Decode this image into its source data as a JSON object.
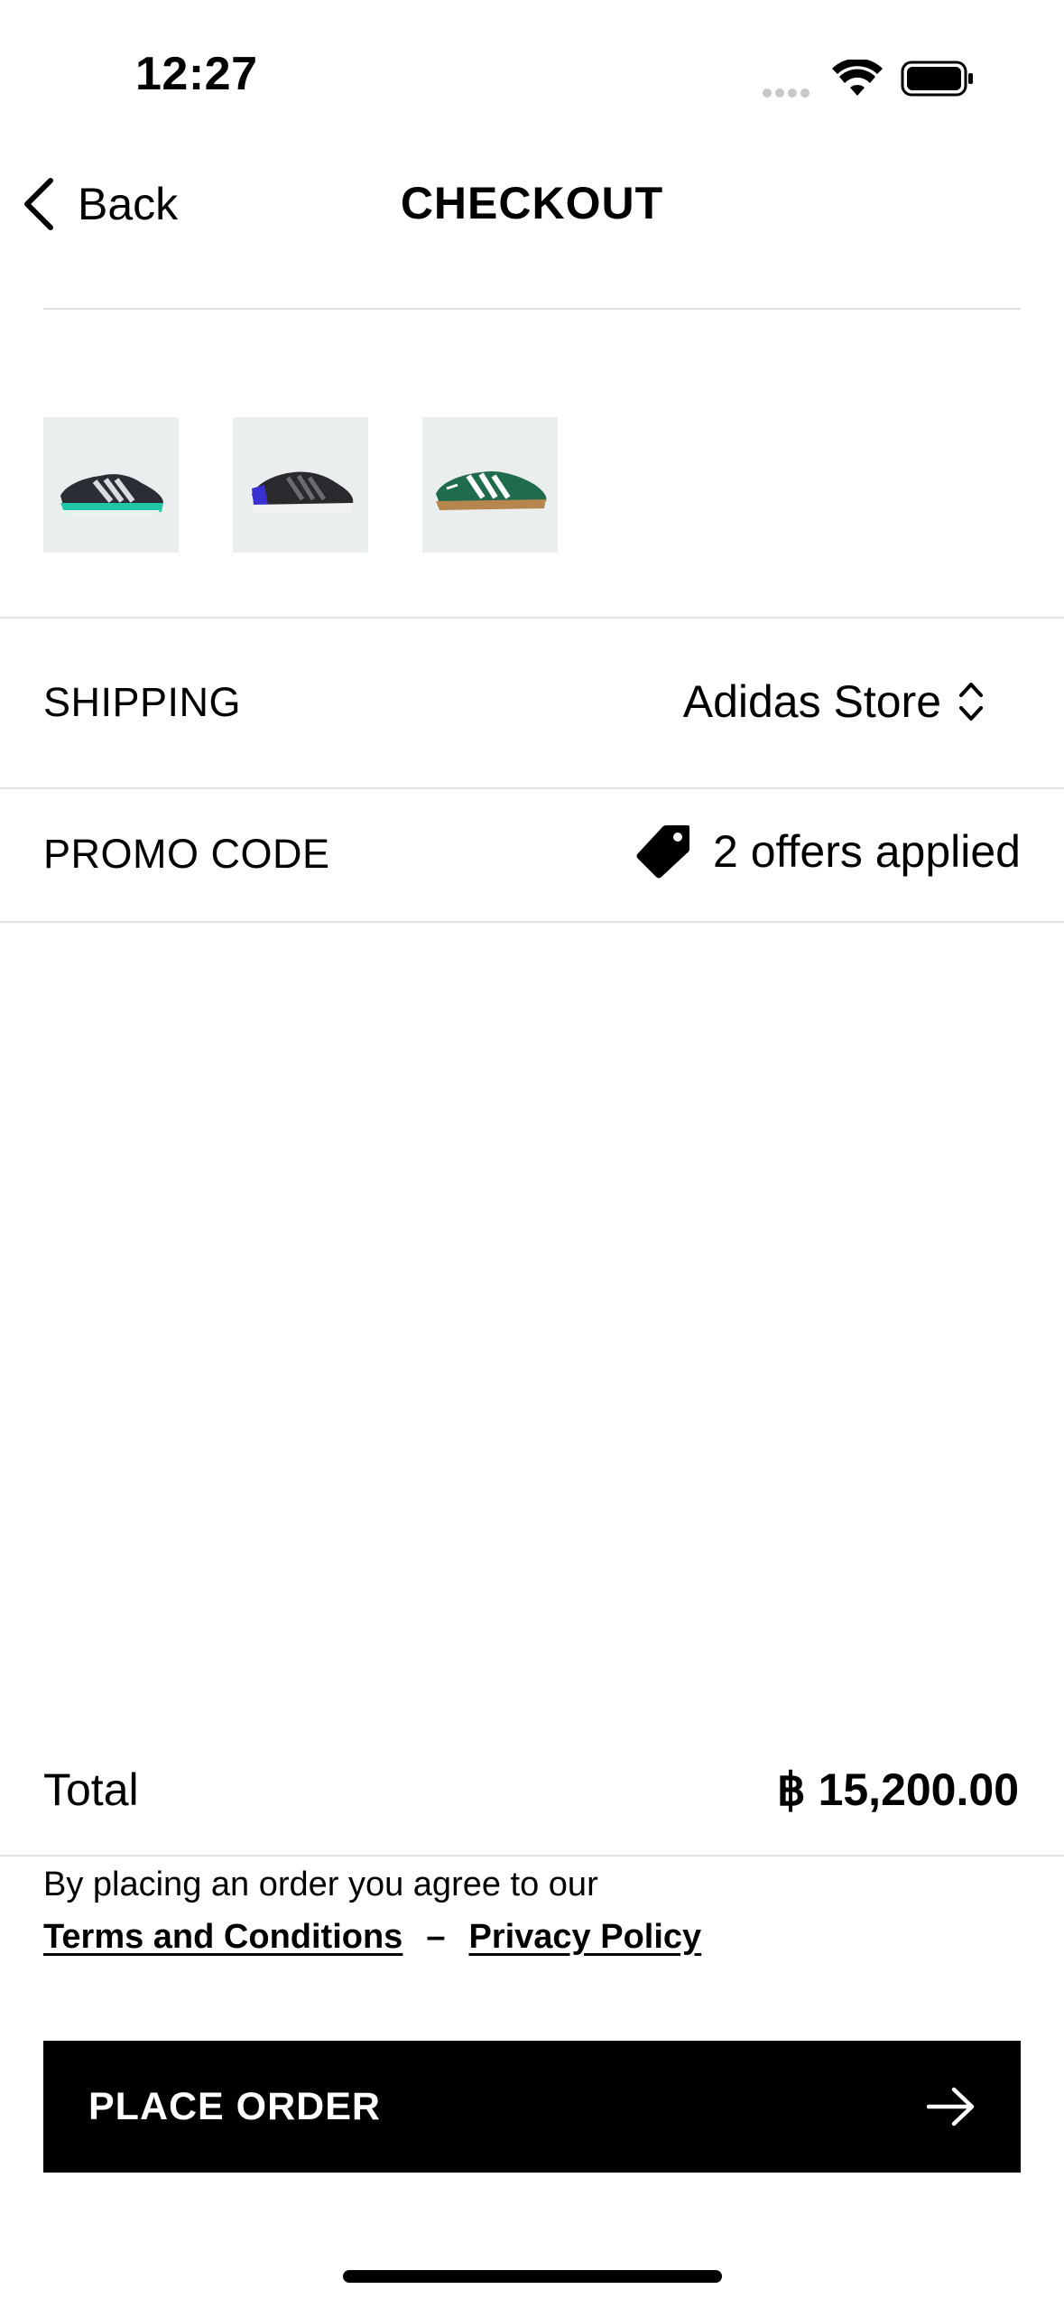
{
  "status_bar": {
    "time": "12:27"
  },
  "nav": {
    "back_label": "Back",
    "title": "CHECKOUT"
  },
  "products": [
    {
      "icon": "running-shoe-teal-black"
    },
    {
      "icon": "running-shoe-black-blue"
    },
    {
      "icon": "sneaker-green-gum"
    }
  ],
  "shipping": {
    "label": "SHIPPING",
    "value": "Adidas Store"
  },
  "promo": {
    "label": "PROMO CODE",
    "value": "2 offers applied"
  },
  "total": {
    "label": "Total",
    "value": "฿ 15,200.00"
  },
  "legal": {
    "agree_text": "By placing an order you agree to our",
    "terms_label": "Terms and Conditions",
    "separator": "–",
    "privacy_label": "Privacy Policy"
  },
  "cta": {
    "label": "PLACE ORDER"
  },
  "colors": {
    "button_bg": "#000000",
    "button_text": "#ffffff",
    "thumb_bg": "#ebeeee",
    "divider": "#e2e2e2"
  }
}
